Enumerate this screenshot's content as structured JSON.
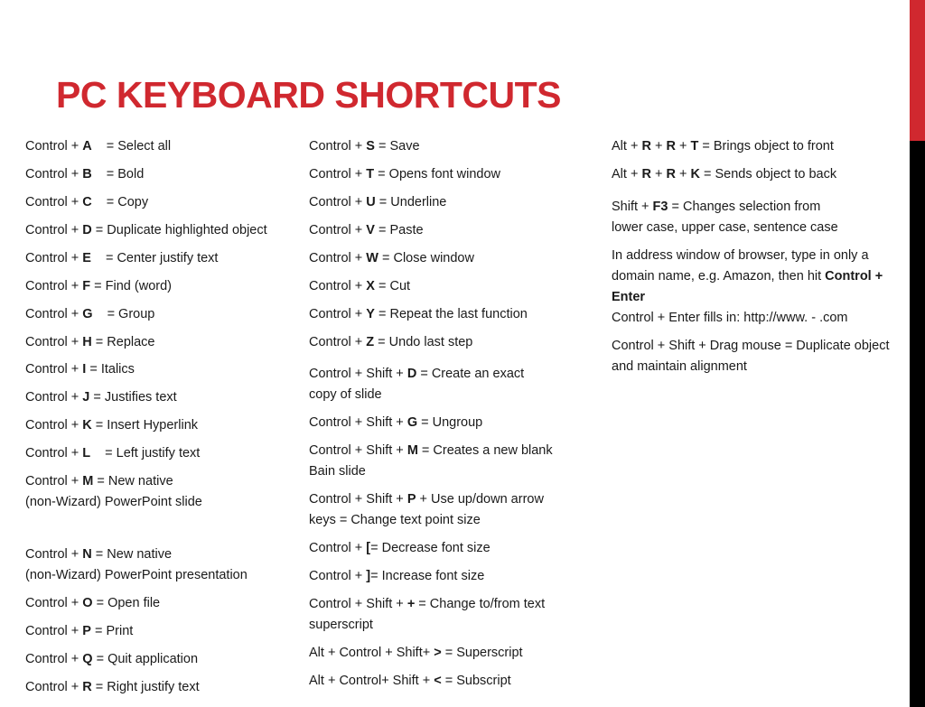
{
  "title": "PC KEYBOARD SHORTCUTS",
  "colors": {
    "accent_red": "#d0282f",
    "side_bar_lower": "#000000",
    "text": "#1a1a1a"
  },
  "columns": [
    {
      "entries": [
        {
          "lines": [
            [
              {
                "t": "Control + "
              },
              {
                "t": "A",
                "b": true
              },
              {
                "t": "  = Select all",
                "gap": true
              }
            ]
          ]
        },
        {
          "lines": [
            [
              {
                "t": "Control + "
              },
              {
                "t": "B",
                "b": true
              },
              {
                "t": "  = Bold",
                "gap": true
              }
            ]
          ]
        },
        {
          "lines": [
            [
              {
                "t": "Control + "
              },
              {
                "t": "C",
                "b": true
              },
              {
                "t": "  = Copy",
                "gap": true
              }
            ]
          ]
        },
        {
          "lines": [
            [
              {
                "t": "Control + "
              },
              {
                "t": "D",
                "b": true
              },
              {
                "t": " = Duplicate highlighted object"
              }
            ]
          ]
        },
        {
          "lines": [
            [
              {
                "t": "Control + "
              },
              {
                "t": "E",
                "b": true
              },
              {
                "t": "  = Center justify text",
                "gap": true
              }
            ]
          ]
        },
        {
          "lines": [
            [
              {
                "t": "Control + "
              },
              {
                "t": "F",
                "b": true
              },
              {
                "t": " = Find (word)"
              }
            ]
          ]
        },
        {
          "lines": [
            [
              {
                "t": "Control + "
              },
              {
                "t": "G",
                "b": true
              },
              {
                "t": "  = Group",
                "gap": true
              }
            ]
          ]
        },
        {
          "lines": [
            [
              {
                "t": "Control + "
              },
              {
                "t": "H",
                "b": true
              },
              {
                "t": " = Replace"
              }
            ]
          ]
        },
        {
          "lines": [
            [
              {
                "t": "Control + "
              },
              {
                "t": "I",
                "b": true
              },
              {
                "t": " = Italics"
              }
            ]
          ]
        },
        {
          "lines": [
            [
              {
                "t": "Control + "
              },
              {
                "t": "J",
                "b": true
              },
              {
                "t": " = Justifies text"
              }
            ]
          ]
        },
        {
          "lines": [
            [
              {
                "t": "Control + "
              },
              {
                "t": "K",
                "b": true
              },
              {
                "t": " = Insert Hyperlink"
              }
            ]
          ]
        },
        {
          "lines": [
            [
              {
                "t": "Control + "
              },
              {
                "t": "L",
                "b": true
              },
              {
                "t": "  = Left justify text",
                "gap": true
              }
            ]
          ]
        },
        {
          "lines": [
            [
              {
                "t": "Control + "
              },
              {
                "t": "M",
                "b": true
              },
              {
                "t": " = New native"
              }
            ],
            [
              {
                "t": "(non-Wizard) PowerPoint slide"
              }
            ]
          ]
        },
        {
          "lines": [
            [
              {
                "t": "Control + "
              },
              {
                "t": "N",
                "b": true
              },
              {
                "t": " = New native"
              }
            ],
            [
              {
                "t": "(non-Wizard) PowerPoint presentation"
              }
            ]
          ]
        },
        {
          "lines": [
            [
              {
                "t": "Control + "
              },
              {
                "t": "O",
                "b": true
              },
              {
                "t": " = Open file"
              }
            ]
          ]
        },
        {
          "lines": [
            [
              {
                "t": "Control + "
              },
              {
                "t": "P",
                "b": true
              },
              {
                "t": " = Print"
              }
            ]
          ]
        },
        {
          "lines": [
            [
              {
                "t": "Control + "
              },
              {
                "t": "Q",
                "b": true
              },
              {
                "t": " = Quit application"
              }
            ]
          ]
        },
        {
          "lines": [
            [
              {
                "t": "Control + "
              },
              {
                "t": "R",
                "b": true
              },
              {
                "t": " = Right justify text"
              }
            ]
          ]
        }
      ]
    },
    {
      "entries": [
        {
          "lines": [
            [
              {
                "t": "Control + "
              },
              {
                "t": "S",
                "b": true
              },
              {
                "t": " = Save"
              }
            ]
          ]
        },
        {
          "lines": [
            [
              {
                "t": "Control + "
              },
              {
                "t": "T",
                "b": true
              },
              {
                "t": " = Opens font window"
              }
            ]
          ]
        },
        {
          "lines": [
            [
              {
                "t": "Control + "
              },
              {
                "t": "U",
                "b": true
              },
              {
                "t": " = Underline"
              }
            ]
          ]
        },
        {
          "lines": [
            [
              {
                "t": "Control + "
              },
              {
                "t": "V",
                "b": true
              },
              {
                "t": " = Paste"
              }
            ]
          ]
        },
        {
          "lines": [
            [
              {
                "t": "Control + "
              },
              {
                "t": "W",
                "b": true
              },
              {
                "t": " = Close window"
              }
            ]
          ]
        },
        {
          "lines": [
            [
              {
                "t": "Control + "
              },
              {
                "t": "X",
                "b": true
              },
              {
                "t": " = Cut"
              }
            ]
          ]
        },
        {
          "lines": [
            [
              {
                "t": "Control + "
              },
              {
                "t": "Y",
                "b": true
              },
              {
                "t": " = Repeat the last function"
              }
            ]
          ]
        },
        {
          "lines": [
            [
              {
                "t": "Control + "
              },
              {
                "t": "Z",
                "b": true
              },
              {
                "t": " = Undo last step"
              }
            ]
          ]
        },
        {
          "lines": [
            [
              {
                "t": "Control + Shift + "
              },
              {
                "t": "D",
                "b": true
              },
              {
                "t": " = Create an exact"
              }
            ],
            [
              {
                "t": "copy of slide"
              }
            ]
          ]
        },
        {
          "lines": [
            [
              {
                "t": "Control + Shift + "
              },
              {
                "t": "G",
                "b": true
              },
              {
                "t": " = Ungroup"
              }
            ]
          ]
        },
        {
          "lines": [
            [
              {
                "t": "Control + Shift + "
              },
              {
                "t": "M",
                "b": true
              },
              {
                "t": " = Creates a new blank"
              }
            ],
            [
              {
                "t": "Bain slide"
              }
            ]
          ]
        },
        {
          "lines": [
            [
              {
                "t": "Control + Shift + "
              },
              {
                "t": "P",
                "b": true
              },
              {
                "t": " + Use up/down arrow"
              }
            ],
            [
              {
                "t": "keys = Change text point size"
              }
            ]
          ]
        },
        {
          "lines": [
            [
              {
                "t": "Control + "
              },
              {
                "t": "[",
                "b": true
              },
              {
                "t": "= Decrease font size"
              }
            ]
          ]
        },
        {
          "lines": [
            [
              {
                "t": "Control + "
              },
              {
                "t": "]",
                "b": true
              },
              {
                "t": "= Increase font size"
              }
            ]
          ]
        },
        {
          "lines": [
            [
              {
                "t": "Control + Shift + "
              },
              {
                "t": "+",
                "b": true
              },
              {
                "t": " = Change to/from text"
              }
            ],
            [
              {
                "t": "superscript"
              }
            ]
          ]
        },
        {
          "lines": [
            [
              {
                "t": "Alt + Control + Shift+ "
              },
              {
                "t": ">",
                "b": true
              },
              {
                "t": " = Superscript"
              }
            ]
          ]
        },
        {
          "lines": [
            [
              {
                "t": "Alt + Control+ Shift + "
              },
              {
                "t": "<",
                "b": true
              },
              {
                "t": " = Subscript"
              }
            ]
          ]
        }
      ]
    },
    {
      "entries": [
        {
          "lines": [
            [
              {
                "t": "Alt + "
              },
              {
                "t": "R",
                "b": true
              },
              {
                "t": " + "
              },
              {
                "t": "R",
                "b": true
              },
              {
                "t": " + "
              },
              {
                "t": "T",
                "b": true
              },
              {
                "t": " = Brings object to front"
              }
            ]
          ]
        },
        {
          "lines": [
            [
              {
                "t": "Alt + "
              },
              {
                "t": "R",
                "b": true
              },
              {
                "t": " + "
              },
              {
                "t": "R",
                "b": true
              },
              {
                "t": " + "
              },
              {
                "t": "K",
                "b": true
              },
              {
                "t": " = Sends object to back"
              }
            ]
          ]
        },
        {
          "lines": [
            [
              {
                "t": "Shift + "
              },
              {
                "t": "F3",
                "b": true
              },
              {
                "t": " = Changes selection from"
              }
            ],
            [
              {
                "t": "lower case, upper case, sentence case"
              }
            ]
          ]
        },
        {
          "lines": [
            [
              {
                "t": "In address window of browser, type in only a"
              }
            ],
            [
              {
                "t": "domain name, e.g. Amazon, then hit "
              },
              {
                "t": "Control +",
                "b": true
              }
            ],
            [
              {
                "t": "Enter",
                "b": true
              }
            ],
            [
              {
                "t": "Control + Enter fills in: http://www.  - .com"
              }
            ]
          ]
        },
        {
          "lines": [
            [
              {
                "t": "Control + Shift + Drag mouse = Duplicate object"
              }
            ],
            [
              {
                "t": "and maintain alignment"
              }
            ]
          ]
        }
      ]
    }
  ]
}
